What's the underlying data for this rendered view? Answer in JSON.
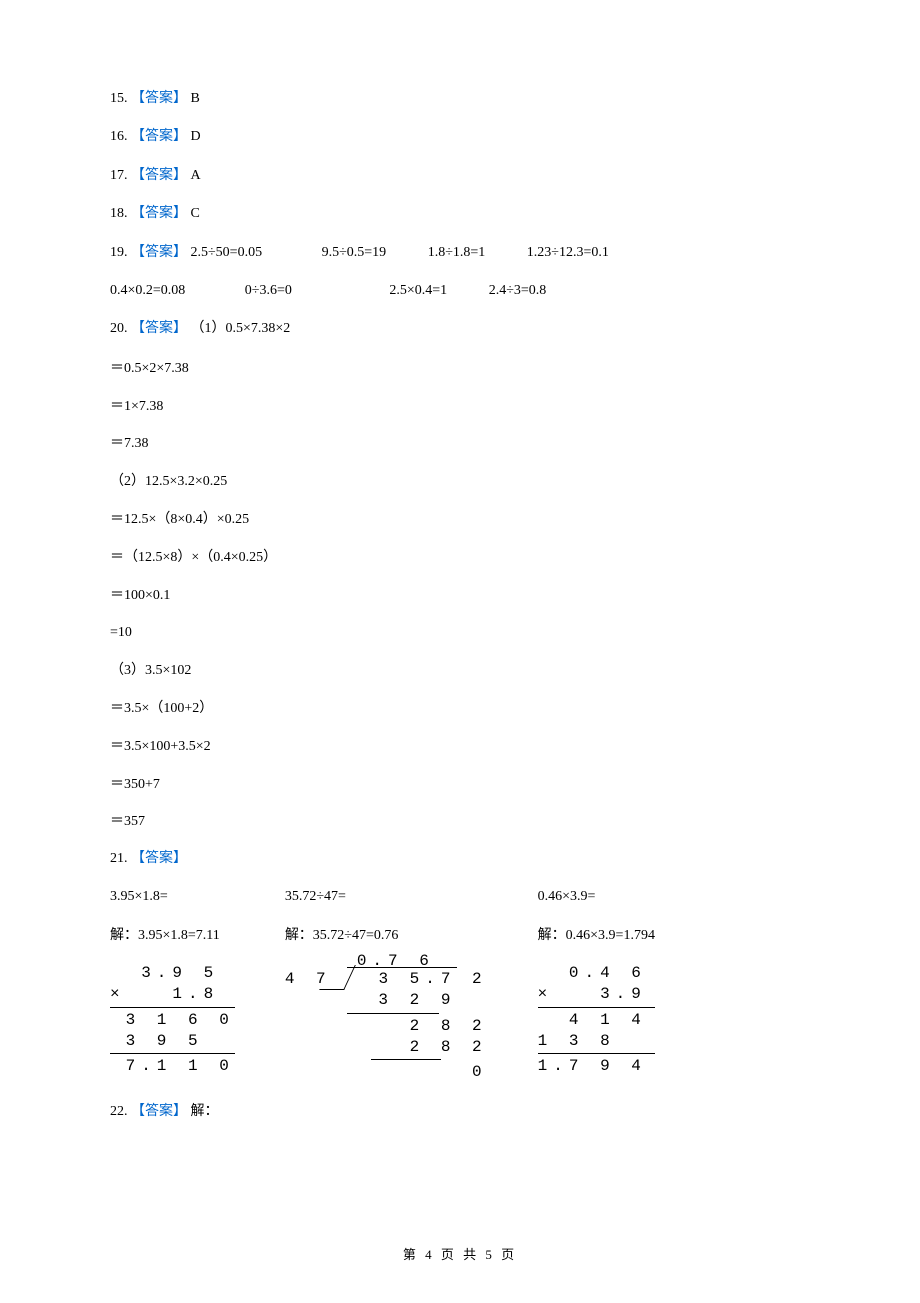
{
  "answerLabel": "【答案】",
  "q15": {
    "num": "15.",
    "ans": "B"
  },
  "q16": {
    "num": "16.",
    "ans": "D"
  },
  "q17": {
    "num": "17.",
    "ans": "A"
  },
  "q18": {
    "num": "18.",
    "ans": "C"
  },
  "q19": {
    "num": "19.",
    "row1": [
      "2.5÷50=0.05",
      "9.5÷0.5=19",
      "1.8÷1.8=1",
      "1.23÷12.3=0.1"
    ],
    "row2": [
      "0.4×0.2=0.08",
      "0÷3.6=0",
      "2.5×0.4=1",
      "2.4÷3=0.8"
    ]
  },
  "q20": {
    "num": "20.",
    "p1": {
      "head": "（1）0.5×7.38×2",
      "lines": [
        "＝0.5×2×7.38",
        "＝1×7.38",
        "＝7.38"
      ]
    },
    "p2": {
      "head": "（2）12.5×3.2×0.25",
      "lines": [
        "＝12.5×（8×0.4）×0.25",
        "＝（12.5×8）×（0.4×0.25）",
        "＝100×0.1",
        "=10"
      ]
    },
    "p3": {
      "head": "（3）3.5×102",
      "lines": [
        "＝3.5×（100+2）",
        "＝3.5×100+3.5×2",
        "＝350+7",
        "＝357"
      ]
    }
  },
  "q21": {
    "num": "21.",
    "c1": {
      "eq": "3.95×1.8=",
      "sol": "解：3.95×1.8=7.11",
      "work": {
        "top": "  3.9 5",
        "mult": "×   1.8",
        "l1": " 3 1 6 0",
        "l2": " 3 9 5  ",
        "res": " 7.1 1 0"
      }
    },
    "c2": {
      "eq": "35.72÷47=",
      "sol": "解：35.72÷47=0.76",
      "work": {
        "divisor": "4 7",
        "dividend": "3 5.7 2",
        "quotient": "0.7 6",
        "l1": "3 2 9",
        "l2": "  2 8 2",
        "l3": "  2 8 2",
        "rem": "      0"
      }
    },
    "c3": {
      "eq": "0.46×3.9=",
      "sol": "解：0.46×3.9=1.794",
      "work": {
        "top": "  0.4 6",
        "mult": "×   3.9",
        "l1": "  4 1 4",
        "l2": "1 3 8  ",
        "res": "1.7 9 4"
      }
    }
  },
  "q22": {
    "num": "22.",
    "text": "解："
  },
  "footer": {
    "prefix": "第",
    "page": "4",
    "mid": "页 共",
    "total": "5",
    "suffix": "页"
  }
}
